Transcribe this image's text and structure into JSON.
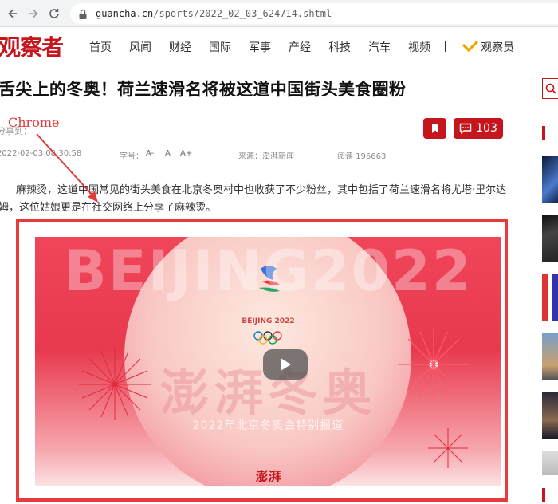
{
  "browser": {
    "url_host": "guancha.cn",
    "url_path": "/sports/2022_02_03_624714.shtml"
  },
  "site": {
    "logo": "观察者",
    "nav": [
      "首页",
      "风闻",
      "财经",
      "国际",
      "军事",
      "产经",
      "科技",
      "汽车",
      "视频"
    ],
    "observer": "观察员"
  },
  "article": {
    "headline": "舌尖上的冬奥！荷兰速滑名将被这道中国街头美食圈粉",
    "share_label": "分享到：",
    "date": "2022-02-03 08:30:58",
    "font_size_label": "字号：",
    "font_small": "A-",
    "font_normal": "A",
    "font_large": "A+",
    "source": "来源：澎湃新闻",
    "reads": "阅读 196663",
    "comment_count": "103",
    "paragraph": "麻辣烫，这道中国常见的街头美食在北京冬奥村中也收获了不少粉丝，其中包括了荷兰速滑名将尤塔·里尔达姆，这位姑娘更是在社交网络上分享了麻辣烫。"
  },
  "annotation": {
    "label": "Chrome"
  },
  "video": {
    "big_text": "BEIJING2022",
    "olympic_text": "BEIJING 2022",
    "calligraphy": "澎湃冬奥",
    "subtitle": "2022年北京冬奥会特别报道",
    "brand": "澎湃"
  },
  "colors": {
    "brand_red": "#c5161d",
    "annotation_red": "#e03b3b"
  }
}
